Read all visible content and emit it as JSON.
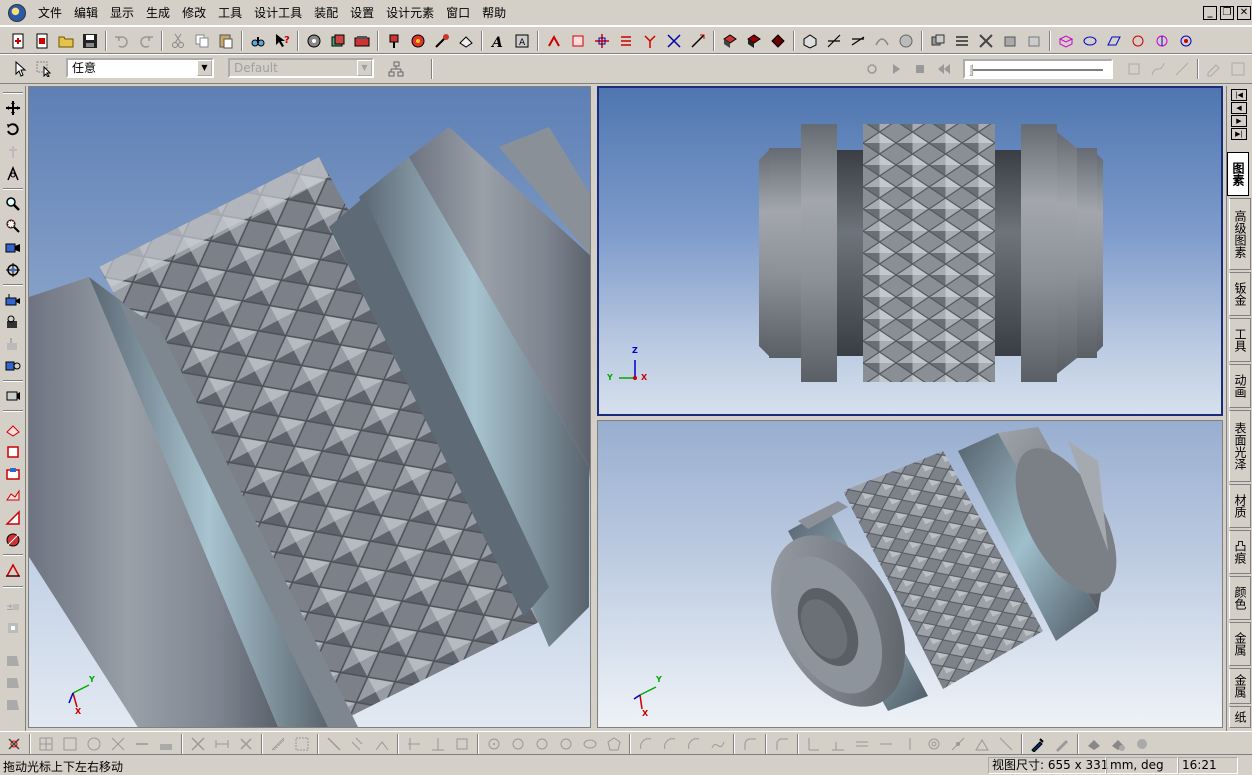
{
  "menu": {
    "items": [
      "文件",
      "编辑",
      "显示",
      "生成",
      "修改",
      "工具",
      "设计工具",
      "装配",
      "设置",
      "设计元素",
      "窗口",
      "帮助"
    ]
  },
  "toolbar2": {
    "filter_value": "任意",
    "style_value": "Default"
  },
  "viewports": {
    "top_axis": {
      "z": "Z",
      "y": "Y",
      "x": "X"
    },
    "left_axis": {
      "y": "Y",
      "x": "X"
    },
    "bottom_axis": {
      "y": "Y",
      "x": "X"
    }
  },
  "right_tabs": [
    "图素",
    "高级图素",
    "钣金",
    "工具",
    "动画",
    "表面光泽",
    "材质",
    "凸痕",
    "颜色",
    "金属",
    "金属纹理",
    "纸"
  ],
  "status": {
    "message": "拖动光标上下左右移动",
    "view_size": "视图尺寸: 655 x 331",
    "units": "mm, deg",
    "time": "16:21"
  }
}
